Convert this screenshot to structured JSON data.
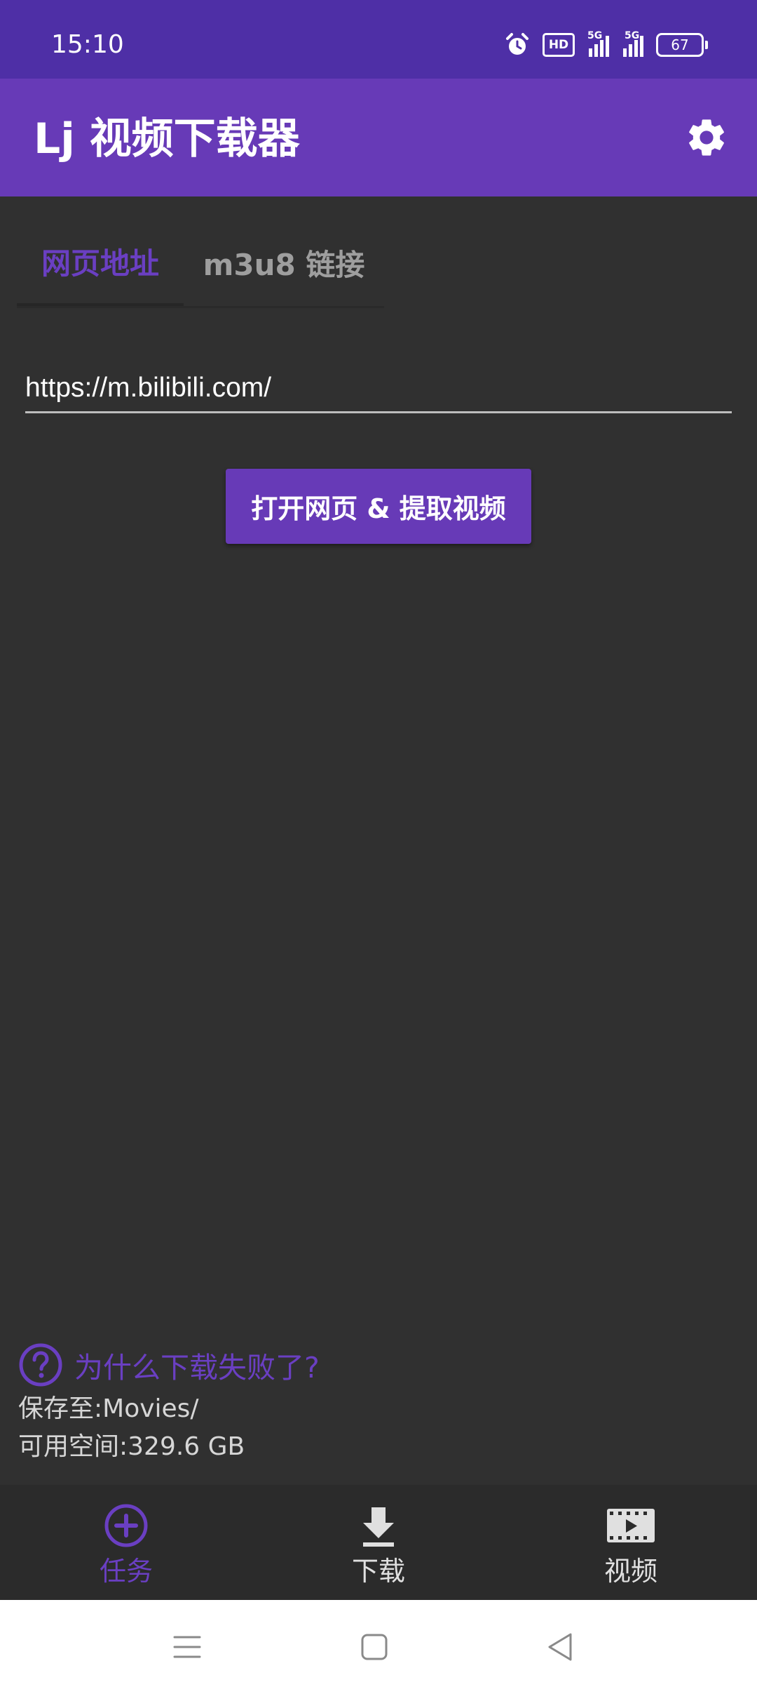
{
  "status_bar": {
    "time": "15:10",
    "hd_label": "HD",
    "network_1": "5G",
    "network_2": "5G",
    "battery": "67"
  },
  "app_bar": {
    "title": "Lj 视频下载器",
    "settings_icon": "gear-icon"
  },
  "tabs": [
    {
      "label": "网页地址",
      "active": true
    },
    {
      "label": "m3u8 链接",
      "active": false
    }
  ],
  "url_input": {
    "value": "https://m.bilibili.com/"
  },
  "open_button": {
    "label": "打开网页 & 提取视频"
  },
  "info": {
    "help_text": "为什么下载失败了?",
    "save_to": "保存至:Movies/",
    "free_space": "可用空间:329.6 GB"
  },
  "bottom_nav": [
    {
      "label": "任务",
      "icon": "add-circle-icon",
      "active": true
    },
    {
      "label": "下载",
      "icon": "download-icon",
      "active": false
    },
    {
      "label": "视频",
      "icon": "movie-icon",
      "active": false
    }
  ],
  "colors": {
    "status_bar": "#4e2fa6",
    "app_bar": "#673ab7",
    "accent": "#6a3fc2",
    "background": "#303030"
  }
}
